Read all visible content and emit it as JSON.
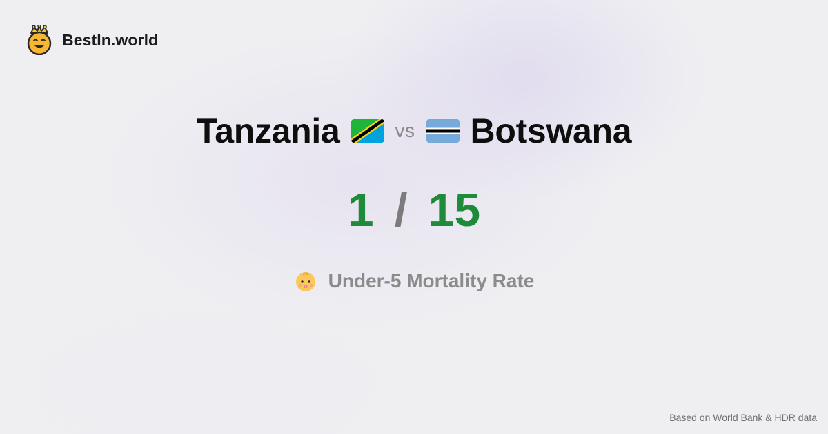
{
  "brand": {
    "name": "BestIn.world",
    "icon": "crown-smiley-icon"
  },
  "comparison": {
    "left": {
      "country": "Tanzania",
      "flag_icon": "tanzania-flag-icon"
    },
    "separator": "vs",
    "right": {
      "country": "Botswana",
      "flag_icon": "botswana-flag-icon"
    }
  },
  "score": {
    "left_value": "1",
    "separator": "/",
    "right_value": "15"
  },
  "metric": {
    "icon": "baby-icon",
    "label": "Under-5 Mortality Rate"
  },
  "footer": {
    "source": "Based on World Bank & HDR data"
  },
  "colors": {
    "background": "#efeff2",
    "score": "#1f8a3a",
    "muted": "#8b8b8b",
    "title": "#0e0e0e"
  }
}
